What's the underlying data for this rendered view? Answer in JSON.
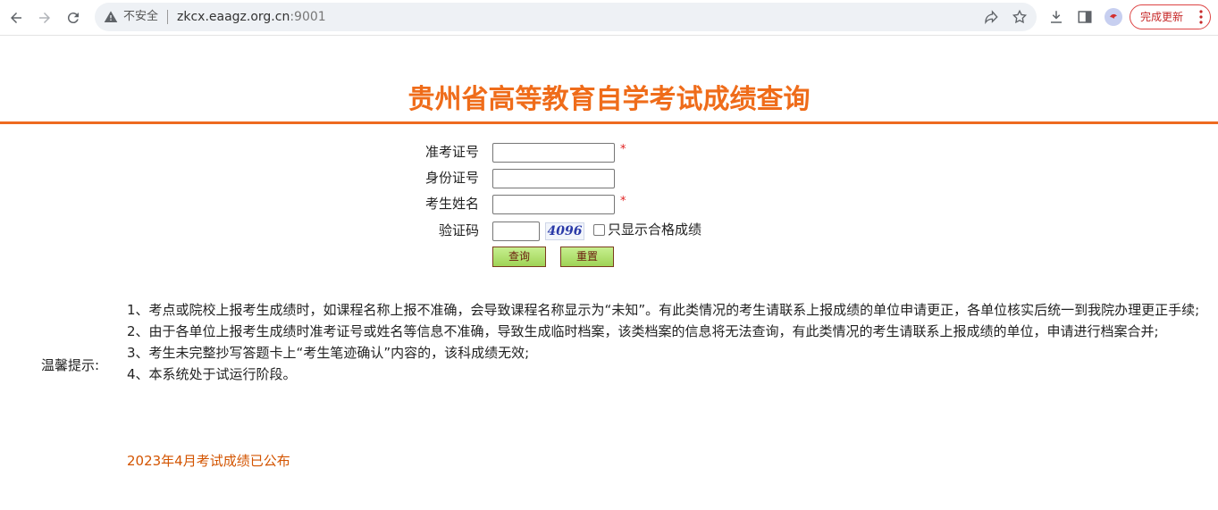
{
  "browser": {
    "insecure_label": "不安全",
    "url_host": "zkcx.eaagz.org.cn",
    "url_port": ":9001",
    "update_label": "完成更新"
  },
  "page": {
    "title": "贵州省高等教育自学考试成绩查询"
  },
  "form": {
    "fields": [
      {
        "label": "准考证号",
        "required_mark": "*"
      },
      {
        "label": "身份证号",
        "required_mark": ""
      },
      {
        "label": "考生姓名",
        "required_mark": "*"
      }
    ],
    "captcha_label": "验证码",
    "captcha_code": "4096",
    "pass_only_label": "只显示合格成绩",
    "query_button": "查询",
    "reset_button": "重置"
  },
  "tips": {
    "label": "温馨提示:",
    "items": [
      "1、考点或院校上报考生成绩时，如课程名称上报不准确，会导致课程名称显示为“未知”。有此类情况的考生请联系上报成绩的单位申请更正，各单位核实后统一到我院办理更正手续;",
      "2、由于各单位上报考生成绩时准考证号或姓名等信息不准确，导致生成临时档案，该类档案的信息将无法查询，有此类情况的考生请联系上报成绩的单位，申请进行档案合并;",
      "3、考生未完整抄写答题卡上“考生笔迹确认”内容的，该科成绩无效;",
      "4、本系统处于试运行阶段。"
    ]
  },
  "notice": "2023年4月考试成绩已公布",
  "colors": {
    "title": "#ef6c1a",
    "notice": "#d35400",
    "required": "#e02020"
  }
}
